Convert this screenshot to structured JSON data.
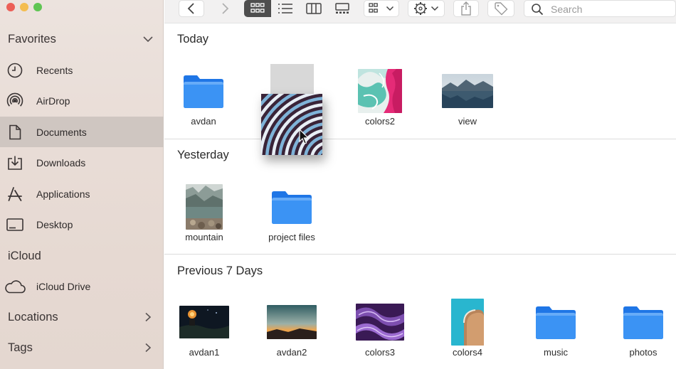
{
  "window": {
    "colors": {
      "sidebar_bg": "#e9ddd7",
      "selected_row": "#cfc6c1",
      "folder_blue": "#2f84ee",
      "toolbar_active": "#4e4e4e"
    }
  },
  "sidebar": {
    "favorites_title": "Favorites",
    "favorites": [
      {
        "label": "Recents",
        "icon": "clock-icon"
      },
      {
        "label": "AirDrop",
        "icon": "airdrop-icon"
      },
      {
        "label": "Documents",
        "icon": "document-icon",
        "selected": true
      },
      {
        "label": "Downloads",
        "icon": "download-icon"
      },
      {
        "label": "Applications",
        "icon": "applications-icon"
      },
      {
        "label": "Desktop",
        "icon": "desktop-icon"
      }
    ],
    "icloud_title": "iCloud",
    "icloud": [
      {
        "label": "iCloud Drive",
        "icon": "cloud-icon"
      }
    ],
    "locations_title": "Locations",
    "tags_title": "Tags"
  },
  "toolbar": {
    "search_placeholder": "Search",
    "view_mode": "icon-view"
  },
  "content": {
    "groups": [
      {
        "title": "Today",
        "items": [
          {
            "name": "avdan",
            "kind": "folder"
          },
          {
            "name": "",
            "kind": "dragging-image"
          },
          {
            "name": "colors2",
            "kind": "image"
          },
          {
            "name": "view",
            "kind": "image"
          }
        ]
      },
      {
        "title": "Yesterday",
        "items": [
          {
            "name": "mountain",
            "kind": "image"
          },
          {
            "name": "project files",
            "kind": "folder"
          }
        ]
      },
      {
        "title": "Previous 7 Days",
        "items": [
          {
            "name": "avdan1",
            "kind": "image"
          },
          {
            "name": "avdan2",
            "kind": "image"
          },
          {
            "name": "colors3",
            "kind": "image"
          },
          {
            "name": "colors4",
            "kind": "image"
          },
          {
            "name": "music",
            "kind": "folder"
          },
          {
            "name": "photos",
            "kind": "folder"
          }
        ]
      }
    ]
  }
}
